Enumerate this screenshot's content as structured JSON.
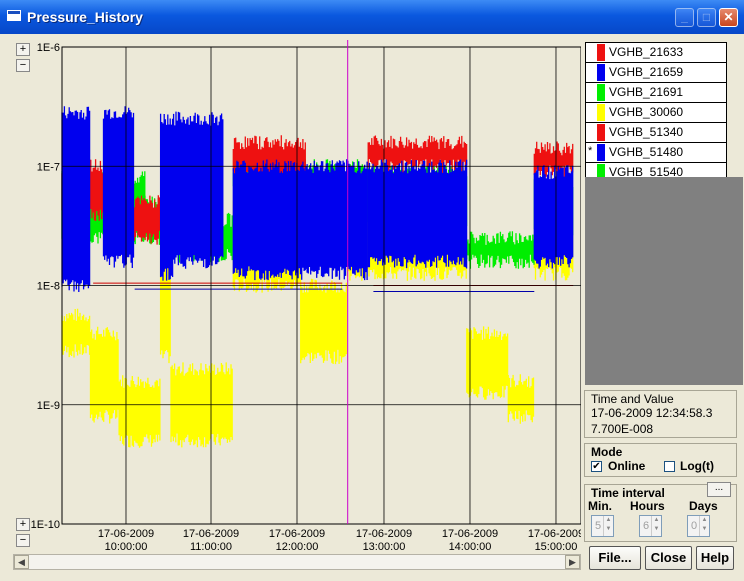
{
  "window": {
    "title": "Pressure_History"
  },
  "colors": {
    "red": "#ee1111",
    "blue": "#0000ee",
    "green": "#00ee00",
    "yellow": "#ffff00",
    "darkred": "#cc0000",
    "darkblue": "#0000aa",
    "cursor": "#cc00cc"
  },
  "zoom": {
    "plus_label": "+",
    "minus_label": "−"
  },
  "chart_data": {
    "type": "line",
    "y_scale": "log",
    "y_ticks": [
      "1E-6",
      "1E-7",
      "1E-8",
      "1E-9",
      "1E-10"
    ],
    "x_ticks": [
      {
        "date": "17-06-2009",
        "time": "10:00:00"
      },
      {
        "date": "17-06-2009",
        "time": "11:00:00"
      },
      {
        "date": "17-06-2009",
        "time": "12:00:00"
      },
      {
        "date": "17-06-2009",
        "time": "13:00:00"
      },
      {
        "date": "17-06-2009",
        "time": "14:00:00"
      },
      {
        "date": "17-06-2009",
        "time": "15:00:00"
      }
    ],
    "grid": true,
    "cursor_time": "12:34:58",
    "series": [
      {
        "name": "VGHB_21633",
        "color": "#ee1111"
      },
      {
        "name": "VGHB_21659",
        "color": "#0000ee"
      },
      {
        "name": "VGHB_21691",
        "color": "#00ee00"
      },
      {
        "name": "VGHB_30060",
        "color": "#ffff00"
      },
      {
        "name": "VGHB_51340",
        "color": "#ee1111"
      },
      {
        "name": "VGHB_51480",
        "color": "#0000ee",
        "marked": "*"
      },
      {
        "name": "VGHB_51540",
        "color": "#00ee00"
      }
    ]
  },
  "time_value": {
    "caption": "Time and Value",
    "time": "17-06-2009 12:34:58.3",
    "value": "7.700E-008"
  },
  "mode": {
    "caption": "Mode",
    "online_label": "Online",
    "online_checked": "✔",
    "log_label": "Log(t)"
  },
  "time_interval": {
    "caption": "Time interval",
    "more_label": "...",
    "min_label": "Min.",
    "hours_label": "Hours",
    "days_label": "Days",
    "min_value": "5",
    "hours_value": "6",
    "days_value": "0"
  },
  "buttons": {
    "file": "File...",
    "close": "Close",
    "help": "Help"
  },
  "scroll": {
    "left_arrow": "◀",
    "right_arrow": "▶"
  }
}
